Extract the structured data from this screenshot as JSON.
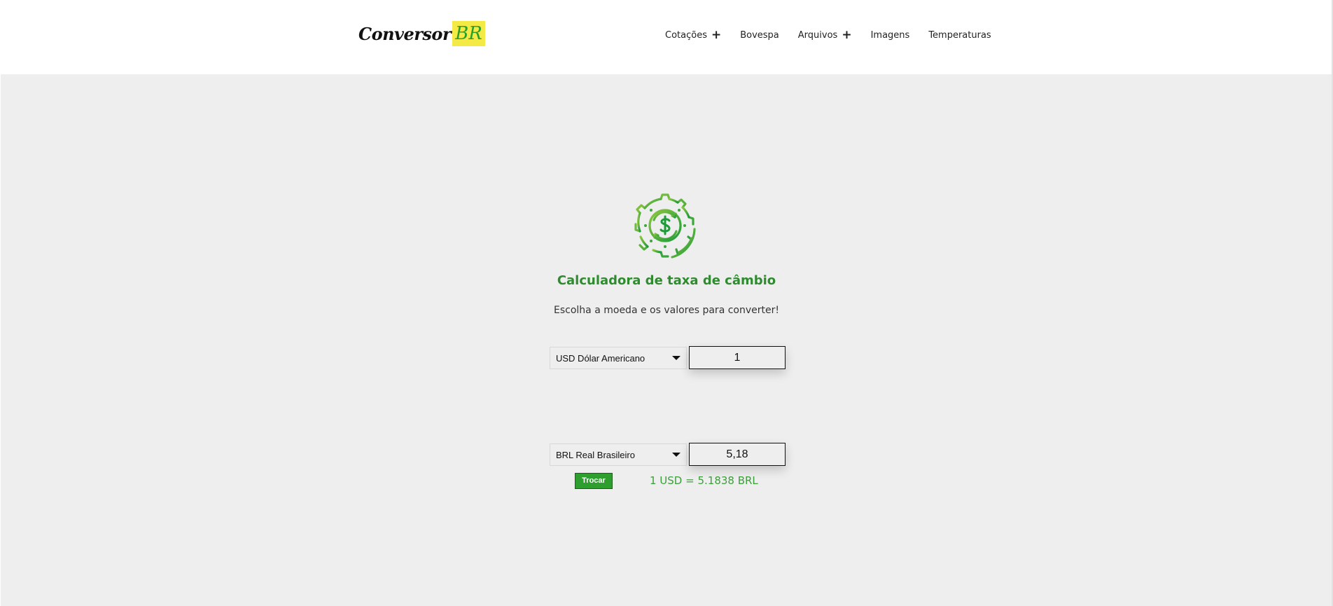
{
  "logo": {
    "text": "Conversor",
    "badge": "BR"
  },
  "nav": {
    "items": [
      {
        "label": "Cotações",
        "has_submenu": true
      },
      {
        "label": "Bovespa",
        "has_submenu": false
      },
      {
        "label": "Arquivos",
        "has_submenu": true
      },
      {
        "label": "Imagens",
        "has_submenu": false
      },
      {
        "label": "Temperaturas",
        "has_submenu": false
      }
    ],
    "submenu_glyph": "+"
  },
  "calculator": {
    "icon": "currency-exchange-gear-icon",
    "title": "Calculadora de taxa de câmbio",
    "subtitle": "Escolha a moeda e os valores para converter!",
    "from": {
      "currency": "USD Dólar Americano",
      "amount": "1"
    },
    "to": {
      "currency": "BRL Real Brasileiro",
      "amount": "5,18"
    },
    "swap_label": "Trocar",
    "rate_text": "1 USD = 5.1838 BRL"
  },
  "colors": {
    "accent_green": "#2e9e2e",
    "title_green": "#2e8b2e",
    "logo_badge_yellow": "#f4ea45",
    "background_gray": "#eeeeee"
  }
}
